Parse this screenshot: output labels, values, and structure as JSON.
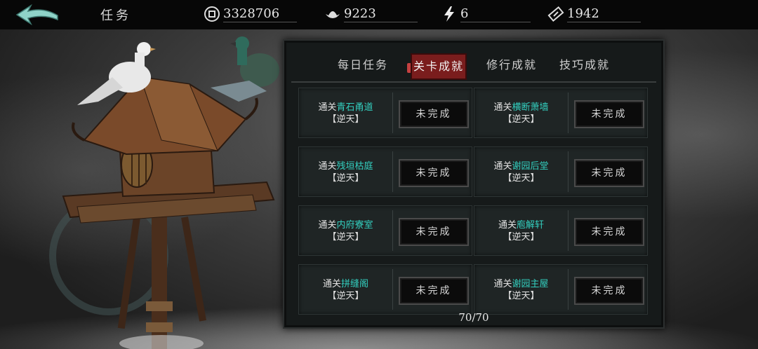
{
  "header": {
    "title": "任务",
    "resources": [
      {
        "icon": "coin-icon",
        "value": "3328706"
      },
      {
        "icon": "silver-ingot-icon",
        "value": "9223"
      },
      {
        "icon": "lightning-icon",
        "value": "6"
      },
      {
        "icon": "ticket-icon",
        "value": "1942"
      }
    ]
  },
  "tabs": [
    {
      "label": "每日任务",
      "active": false
    },
    {
      "label": "关卡成就",
      "active": true
    },
    {
      "label": "修行成就",
      "active": false
    },
    {
      "label": "技巧成就",
      "active": false
    }
  ],
  "achievements": [
    {
      "prefix": "通关",
      "stage": "青石甬道",
      "difficulty": "【逆天】",
      "status": "未完成"
    },
    {
      "prefix": "通关",
      "stage": "横断萧墙",
      "difficulty": "【逆天】",
      "status": "未完成"
    },
    {
      "prefix": "通关",
      "stage": "残垣枯庭",
      "difficulty": "【逆天】",
      "status": "未完成"
    },
    {
      "prefix": "通关",
      "stage": "谢园后堂",
      "difficulty": "【逆天】",
      "status": "未完成"
    },
    {
      "prefix": "通关",
      "stage": "内府寮室",
      "difficulty": "【逆天】",
      "status": "未完成"
    },
    {
      "prefix": "通关",
      "stage": "庖解轩",
      "difficulty": "【逆天】",
      "status": "未完成"
    },
    {
      "prefix": "通关",
      "stage": "拼缝阁",
      "difficulty": "【逆天】",
      "status": "未完成"
    },
    {
      "prefix": "通关",
      "stage": "谢园主屋",
      "difficulty": "【逆天】",
      "status": "未完成"
    }
  ],
  "progress": "70/70",
  "colors": {
    "highlight": "#33d0c0",
    "active_tab": "#7a1d1d",
    "back_arrow": "#8fd3c8"
  }
}
